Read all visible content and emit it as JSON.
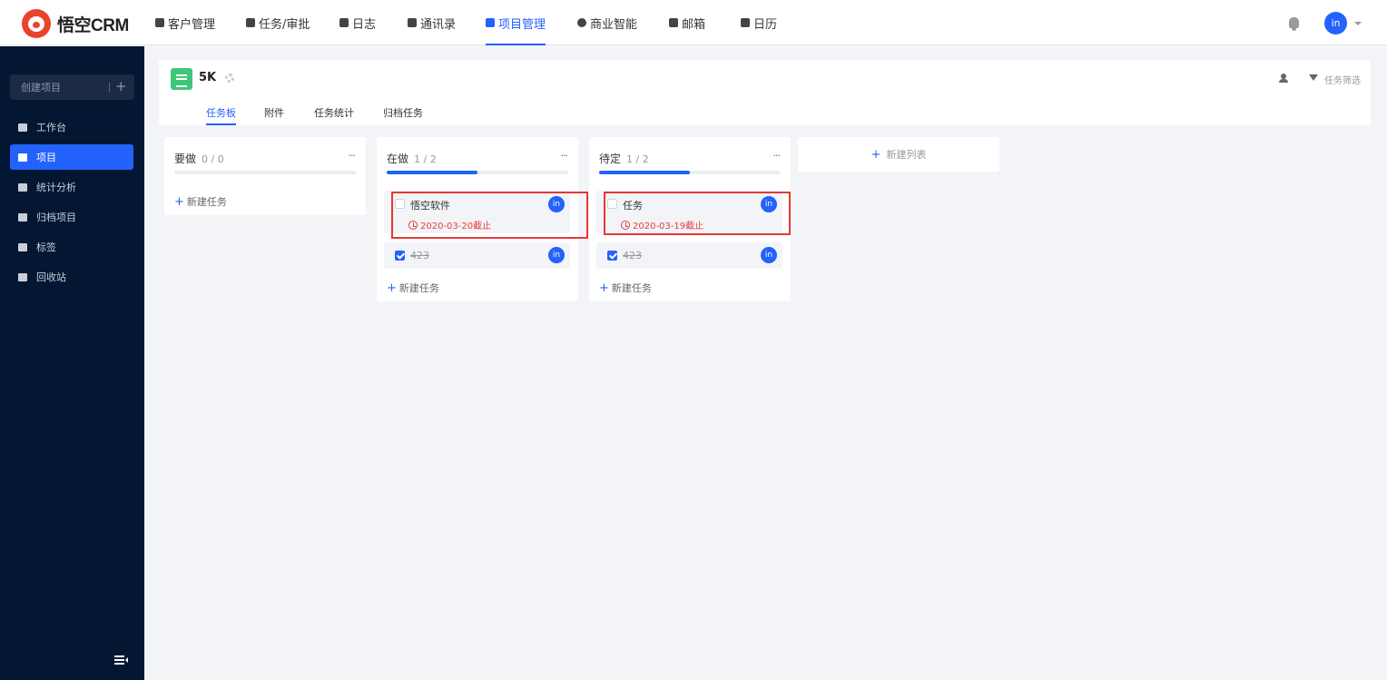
{
  "app": {
    "name": "悟空CRM",
    "user_initials": "in"
  },
  "topnav": {
    "items": [
      {
        "label": "客户管理",
        "icon": "building-icon"
      },
      {
        "label": "任务/审批",
        "icon": "briefcase-icon"
      },
      {
        "label": "日志",
        "icon": "log-icon"
      },
      {
        "label": "通讯录",
        "icon": "contacts-icon"
      },
      {
        "label": "项目管理",
        "icon": "project-icon",
        "active": true
      },
      {
        "label": "商业智能",
        "icon": "shield-icon"
      },
      {
        "label": "邮箱",
        "icon": "mail-icon"
      },
      {
        "label": "日历",
        "icon": "calendar-icon"
      }
    ]
  },
  "sidebar": {
    "create_label": "创建项目",
    "create_plus": "+",
    "items": [
      {
        "label": "工作台",
        "icon": "desktop-icon"
      },
      {
        "label": "项目",
        "icon": "project-icon",
        "active": true
      },
      {
        "label": "统计分析",
        "icon": "chart-icon"
      },
      {
        "label": "归档项目",
        "icon": "archive-icon"
      },
      {
        "label": "标签",
        "icon": "tag-icon"
      },
      {
        "label": "回收站",
        "icon": "trash-icon"
      }
    ]
  },
  "project": {
    "name": "5K",
    "filter_label": "任务筛选",
    "tabs": [
      "任务板",
      "附件",
      "任务统计",
      "归档任务"
    ]
  },
  "columns": [
    {
      "title": "要做",
      "count": "0 / 0",
      "more": "···",
      "progress": 0,
      "new_task": "新建任务",
      "tasks": []
    },
    {
      "title": "在做",
      "count": "1 / 2",
      "more": "···",
      "progress": 0.5,
      "new_task": "新建任务",
      "tasks": [
        {
          "name": "悟空软件",
          "due": "2020-03-20截止",
          "done": false,
          "assignee": "in",
          "highlighted": true
        },
        {
          "name": "423",
          "done": true,
          "assignee": "in"
        }
      ]
    },
    {
      "title": "待定",
      "count": "1 / 2",
      "more": "···",
      "progress": 0.5,
      "new_task": "新建任务",
      "tasks": [
        {
          "name": "任务",
          "due": "2020-03-19截止",
          "done": false,
          "assignee": "in",
          "highlighted": true
        },
        {
          "name": "423",
          "done": true,
          "assignee": "in"
        }
      ]
    }
  ],
  "new_list_label": "新建列表",
  "colors": {
    "accent": "#2362fb",
    "sidebar_bg": "#031733",
    "due_red": "#e53c3c",
    "highlight_box": "#e53935",
    "project_icon": "#3ec67a"
  }
}
